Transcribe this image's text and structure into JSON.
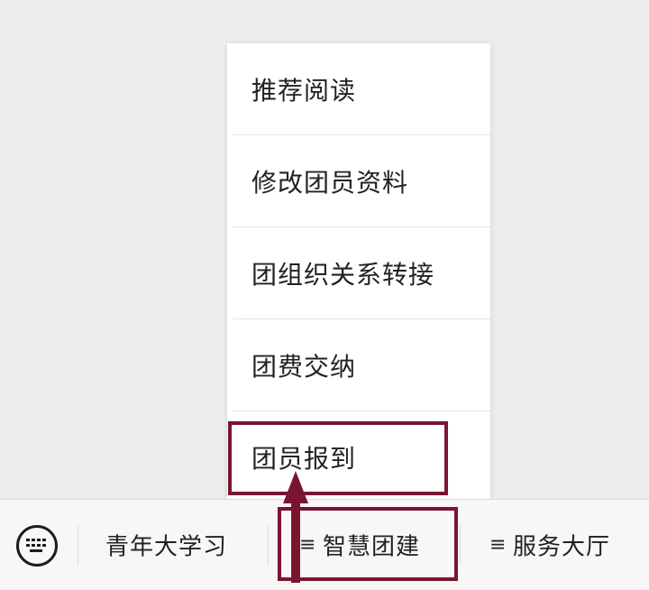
{
  "popup_menu": {
    "items": [
      {
        "label": "推荐阅读"
      },
      {
        "label": "修改团员资料"
      },
      {
        "label": "团组织关系转接"
      },
      {
        "label": "团费交纳"
      },
      {
        "label": "团员报到"
      }
    ]
  },
  "bottom_bar": {
    "keyboard_icon": "keyboard-icon",
    "tabs": [
      {
        "label": "青年大学习"
      },
      {
        "label": "智慧团建",
        "icon": "≡"
      },
      {
        "label": "服务大厅",
        "icon": "≡"
      }
    ]
  },
  "annotation": {
    "color": "#7a1530"
  }
}
